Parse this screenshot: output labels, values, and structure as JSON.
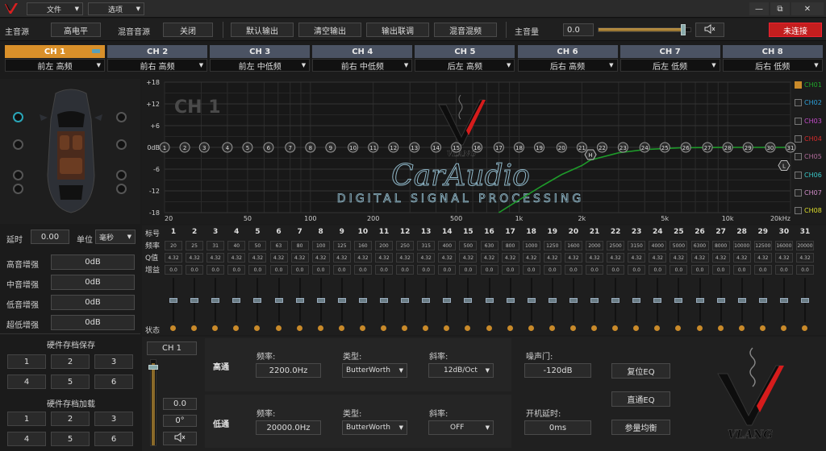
{
  "menu": {
    "file": "文件",
    "options": "选项"
  },
  "window_controls": {
    "min": "—",
    "restore": "⧉",
    "close": "✕"
  },
  "toolbar": {
    "main_source_label": "主音源",
    "main_source_value": "高电平",
    "mix_source_label": "混音音源",
    "mix_source_value": "关闭",
    "default_output": "默认输出",
    "clear_output": "清空输出",
    "output_link": "输出联调",
    "mix_band": "混音混频",
    "master_volume_label": "主音量",
    "master_volume_value": "0.0",
    "master_volume_level": 0.92,
    "connection_status": "未连接"
  },
  "channels": [
    {
      "name": "CH 1",
      "position": "前左 高频",
      "active": true
    },
    {
      "name": "CH 2",
      "position": "前右 高频"
    },
    {
      "name": "CH 3",
      "position": "前左 中低频"
    },
    {
      "name": "CH 4",
      "position": "前右 中低频"
    },
    {
      "name": "CH 5",
      "position": "后左 高频"
    },
    {
      "name": "CH 6",
      "position": "后右 高频"
    },
    {
      "name": "CH 7",
      "position": "后左 低频"
    },
    {
      "name": "CH 8",
      "position": "后右 低频"
    }
  ],
  "left_panel": {
    "delay_label": "延时",
    "delay_value": "0.00",
    "unit_label": "单位",
    "unit_value": "毫秒",
    "gains": [
      {
        "label": "高音增强",
        "value": "0dB"
      },
      {
        "label": "中音增强",
        "value": "0dB"
      },
      {
        "label": "低音增强",
        "value": "0dB"
      },
      {
        "label": "超低增强",
        "value": "0dB"
      }
    ],
    "save_title": "硬件存档保存",
    "load_title": "硬件存档加载",
    "presets": [
      "1",
      "2",
      "3",
      "4",
      "5",
      "6"
    ]
  },
  "chart_data": {
    "type": "line",
    "title": "CH 1",
    "y_ticks": [
      "+18",
      "+12",
      "+6",
      "0dB",
      "-6",
      "-12",
      "-18"
    ],
    "ylim": [
      -18,
      18
    ],
    "x_ticks": [
      "20",
      "50",
      "100",
      "200",
      "500",
      "1k",
      "2k",
      "5k",
      "10k",
      "20kHz"
    ],
    "xlim": [
      20,
      20000
    ],
    "x_scale": "log",
    "grid": true,
    "eq_points": [
      {
        "label": "1",
        "freq": 20,
        "gain": 0
      },
      {
        "label": "2",
        "freq": 25,
        "gain": 0
      },
      {
        "label": "3",
        "freq": 31,
        "gain": 0
      },
      {
        "label": "4",
        "freq": 40,
        "gain": 0
      },
      {
        "label": "5",
        "freq": 50,
        "gain": 0
      },
      {
        "label": "6",
        "freq": 63,
        "gain": 0
      },
      {
        "label": "7",
        "freq": 80,
        "gain": 0
      },
      {
        "label": "8",
        "freq": 100,
        "gain": 0
      },
      {
        "label": "9",
        "freq": 125,
        "gain": 0
      },
      {
        "label": "10",
        "freq": 160,
        "gain": 0
      },
      {
        "label": "11",
        "freq": 200,
        "gain": 0
      },
      {
        "label": "12",
        "freq": 250,
        "gain": 0
      },
      {
        "label": "13",
        "freq": 315,
        "gain": 0
      },
      {
        "label": "14",
        "freq": 400,
        "gain": 0
      },
      {
        "label": "15",
        "freq": 500,
        "gain": 0
      },
      {
        "label": "16",
        "freq": 630,
        "gain": 0
      },
      {
        "label": "17",
        "freq": 800,
        "gain": 0
      },
      {
        "label": "18",
        "freq": 1000,
        "gain": 0
      },
      {
        "label": "19",
        "freq": 1250,
        "gain": 0
      },
      {
        "label": "20",
        "freq": 1600,
        "gain": 0
      },
      {
        "label": "21",
        "freq": 2000,
        "gain": 0
      },
      {
        "label": "22",
        "freq": 2500,
        "gain": 0
      },
      {
        "label": "23",
        "freq": 3150,
        "gain": 0
      },
      {
        "label": "24",
        "freq": 4000,
        "gain": 0
      },
      {
        "label": "25",
        "freq": 5000,
        "gain": 0
      },
      {
        "label": "26",
        "freq": 6300,
        "gain": 0
      },
      {
        "label": "27",
        "freq": 8000,
        "gain": 0
      },
      {
        "label": "28",
        "freq": 10000,
        "gain": 0
      },
      {
        "label": "29",
        "freq": 12500,
        "gain": 0
      },
      {
        "label": "30",
        "freq": 16000,
        "gain": 0
      },
      {
        "label": "31",
        "freq": 20000,
        "gain": 0
      }
    ],
    "markers": [
      {
        "label": "H",
        "freq": 2200,
        "gain": -2
      },
      {
        "label": "L",
        "freq": 20000,
        "gain": -5
      }
    ],
    "response_curve": [
      {
        "freq": 800,
        "gain": -18
      },
      {
        "freq": 1000,
        "gain": -14.5
      },
      {
        "freq": 1300,
        "gain": -10.5
      },
      {
        "freq": 1600,
        "gain": -7.5
      },
      {
        "freq": 2000,
        "gain": -5
      },
      {
        "freq": 2200,
        "gain": -3.5
      },
      {
        "freq": 3000,
        "gain": -1.5
      },
      {
        "freq": 4000,
        "gain": -0.6
      },
      {
        "freq": 6000,
        "gain": -0.1
      },
      {
        "freq": 10000,
        "gain": 0
      },
      {
        "freq": 20000,
        "gain": 0
      }
    ],
    "curve_color": "#1e9a2a",
    "legend": [
      {
        "name": "CH01",
        "color": "#1fa82a",
        "checked": true
      },
      {
        "name": "CH02",
        "color": "#2c9fd9"
      },
      {
        "name": "CH03",
        "color": "#c64ccc"
      },
      {
        "name": "CH04",
        "color": "#d42a2a"
      },
      {
        "name": "CH05",
        "color": "#b06a9a"
      },
      {
        "name": "CH06",
        "color": "#38c7c7"
      },
      {
        "name": "CH07",
        "color": "#d18cc9"
      },
      {
        "name": "CH08",
        "color": "#dede2a"
      }
    ]
  },
  "watermark": {
    "brand": "CarAudio",
    "subtitle": "DIGITAL SIGNAL PROCESSING",
    "logo": "VLANG"
  },
  "eq_table": {
    "row_labels": [
      "标号",
      "频率",
      "Q值",
      "增益"
    ],
    "status_label": "状态",
    "bands": [
      "1",
      "2",
      "3",
      "4",
      "5",
      "6",
      "7",
      "8",
      "9",
      "10",
      "11",
      "12",
      "13",
      "14",
      "15",
      "16",
      "17",
      "18",
      "19",
      "20",
      "21",
      "22",
      "23",
      "24",
      "25",
      "26",
      "27",
      "28",
      "29",
      "30",
      "31"
    ],
    "freqs": [
      "20",
      "25",
      "31",
      "40",
      "50",
      "63",
      "80",
      "100",
      "125",
      "160",
      "200",
      "250",
      "315",
      "400",
      "500",
      "630",
      "800",
      "1000",
      "1250",
      "1600",
      "2000",
      "2500",
      "3150",
      "4000",
      "5000",
      "6300",
      "8000",
      "10000",
      "12500",
      "16000",
      "20000"
    ],
    "q": "4.32",
    "gain": "0.0",
    "slider_level": 0.5
  },
  "bottom": {
    "channel": "CH 1",
    "vol_value": "0.0",
    "phase_value": "0°",
    "highpass_label": "高通",
    "lowpass_label": "低通",
    "freq_label": "频率:",
    "type_label": "类型:",
    "slope_label": "斜率:",
    "hp_freq": "2200.0Hz",
    "hp_type": "ButterWorth",
    "hp_slope": "12dB/Oct",
    "lp_freq": "20000.0Hz",
    "lp_type": "ButterWorth",
    "lp_slope": "OFF",
    "noise_gate_label": "噪声门:",
    "noise_gate_value": "-120dB",
    "boot_delay_label": "开机延时:",
    "boot_delay_value": "0ms",
    "reset_eq": "复位EQ",
    "bypass_eq": "直通EQ",
    "param_balance": "参量均衡"
  }
}
